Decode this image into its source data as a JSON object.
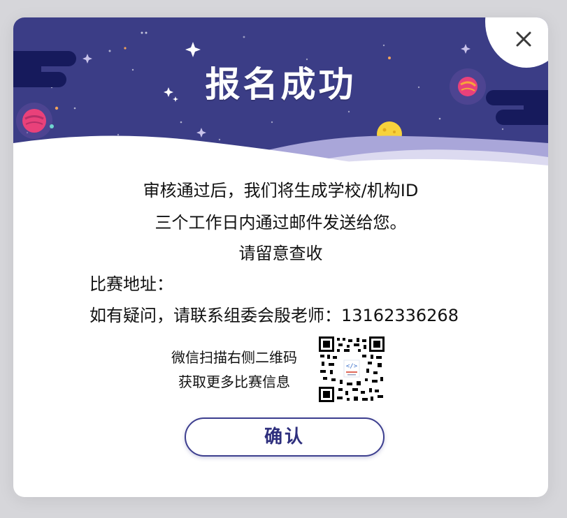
{
  "dialog": {
    "title": "报名成功",
    "message_line1": "审核通过后，我们将生成学校/机构ID",
    "message_line2": "三个工作日内通过邮件发送给您。",
    "message_line3": "请留意查收",
    "address_label": "比赛地址：",
    "contact_line": "如有疑问，请联系组委会殷老师：13162336268",
    "qr_caption_line1": "微信扫描右侧二维码",
    "qr_caption_line2": "获取更多比赛信息",
    "confirm_label": "确认",
    "close_icon": "close-icon"
  },
  "colors": {
    "banner_bg": "#3b3d86",
    "banner_dark": "#161a5c",
    "accent": "#3d3f8f",
    "planet_pink": "#e9417a",
    "planet_yellow": "#f7d23c"
  }
}
